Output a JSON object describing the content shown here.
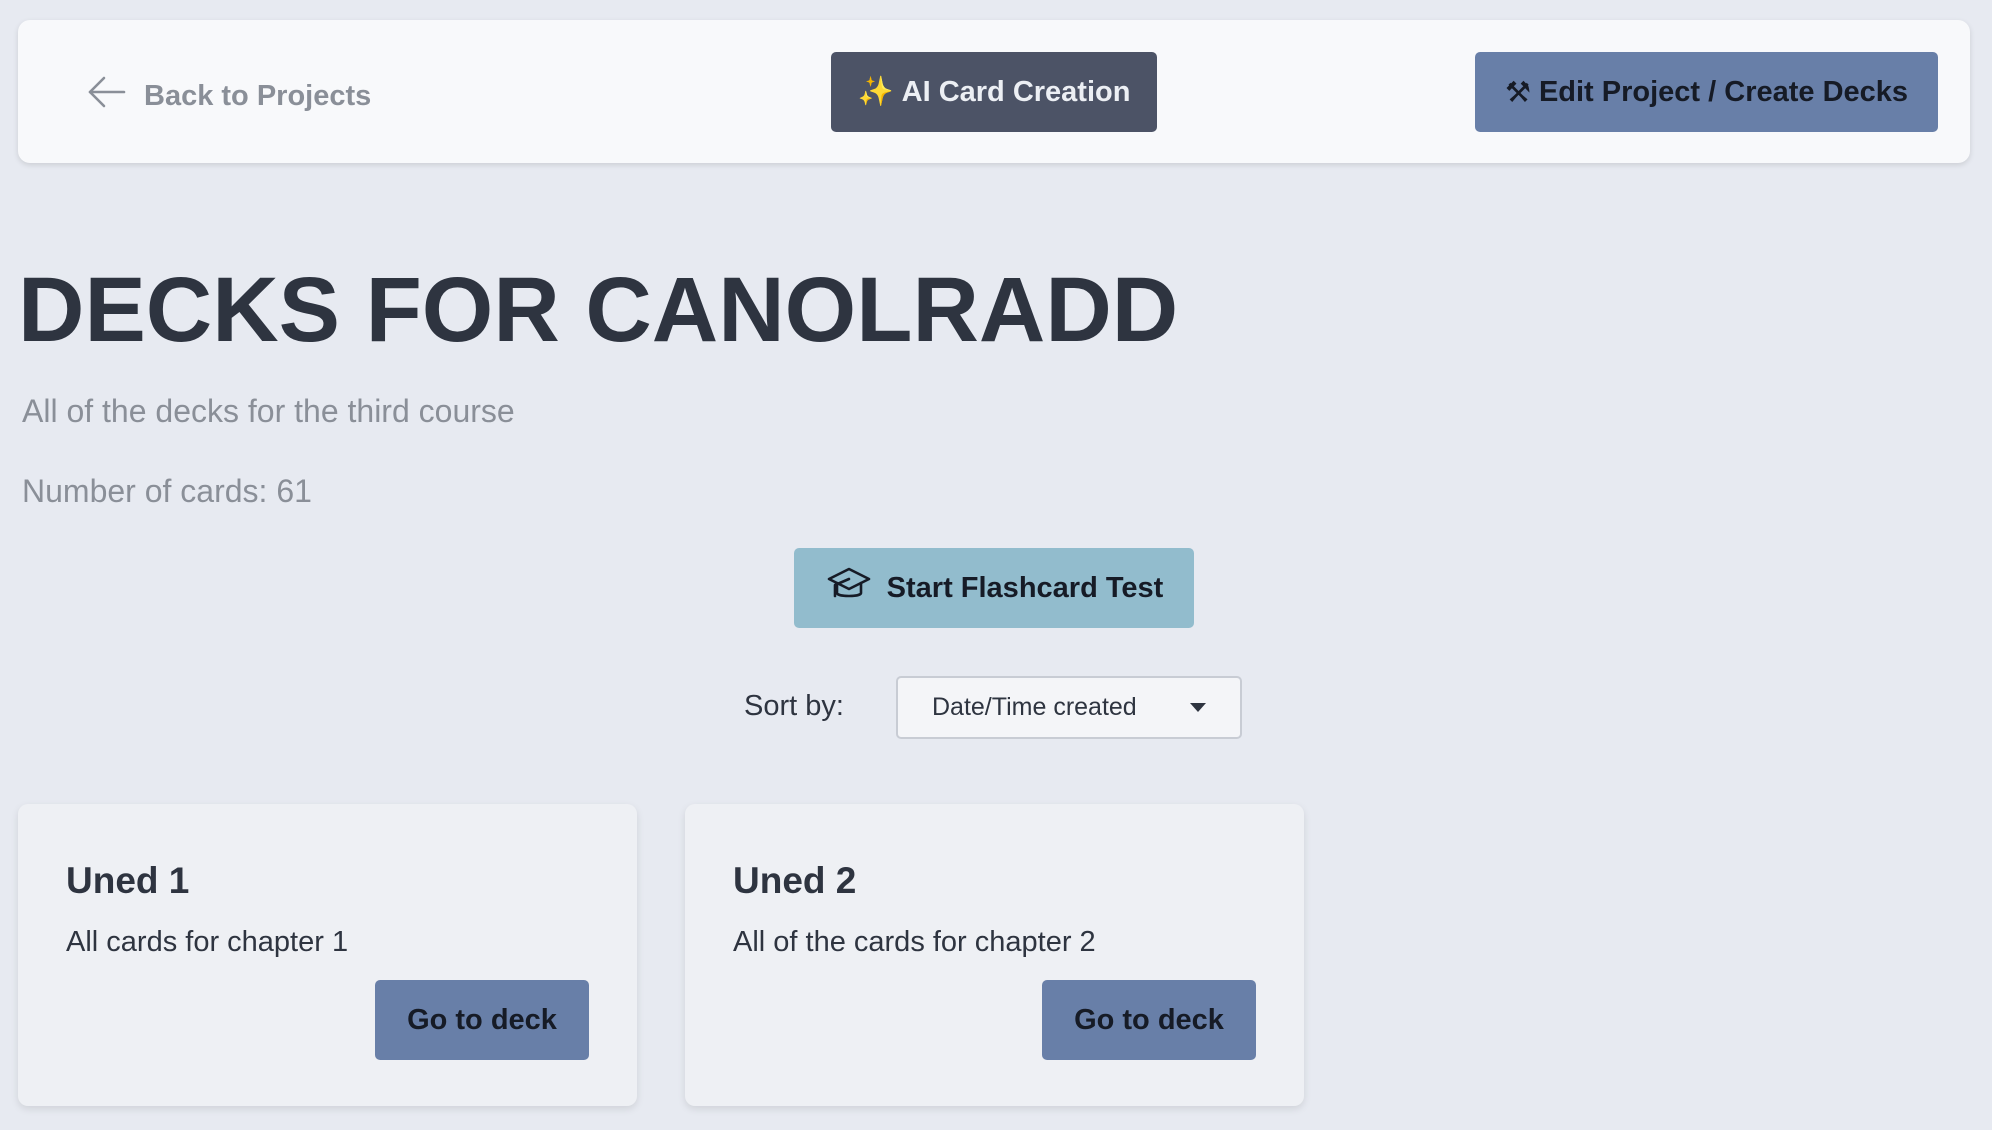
{
  "header": {
    "back_label": "Back to Projects",
    "ai_button_icon": "✨",
    "ai_button_label": "AI Card Creation",
    "edit_button_icon": "⚒",
    "edit_button_label": "Edit Project / Create Decks"
  },
  "page": {
    "title": "DECKS FOR CANOLRADD",
    "subtitle": "All of the decks for the third course",
    "card_count": "Number of cards: 61",
    "test_button_label": "Start Flashcard Test"
  },
  "sort": {
    "label": "Sort by:",
    "selected": "Date/Time created"
  },
  "decks": [
    {
      "title": "Uned 1",
      "description": "All cards for chapter 1",
      "button_label": "Go to deck"
    },
    {
      "title": "Uned 2",
      "description": "All of the cards for chapter 2",
      "button_label": "Go to deck"
    }
  ],
  "colors": {
    "background": "#e7eaf1",
    "primary_button": "#687fa8",
    "dark_button": "#4c5366",
    "test_button": "#92bccd",
    "text_muted": "#8a8f98"
  }
}
